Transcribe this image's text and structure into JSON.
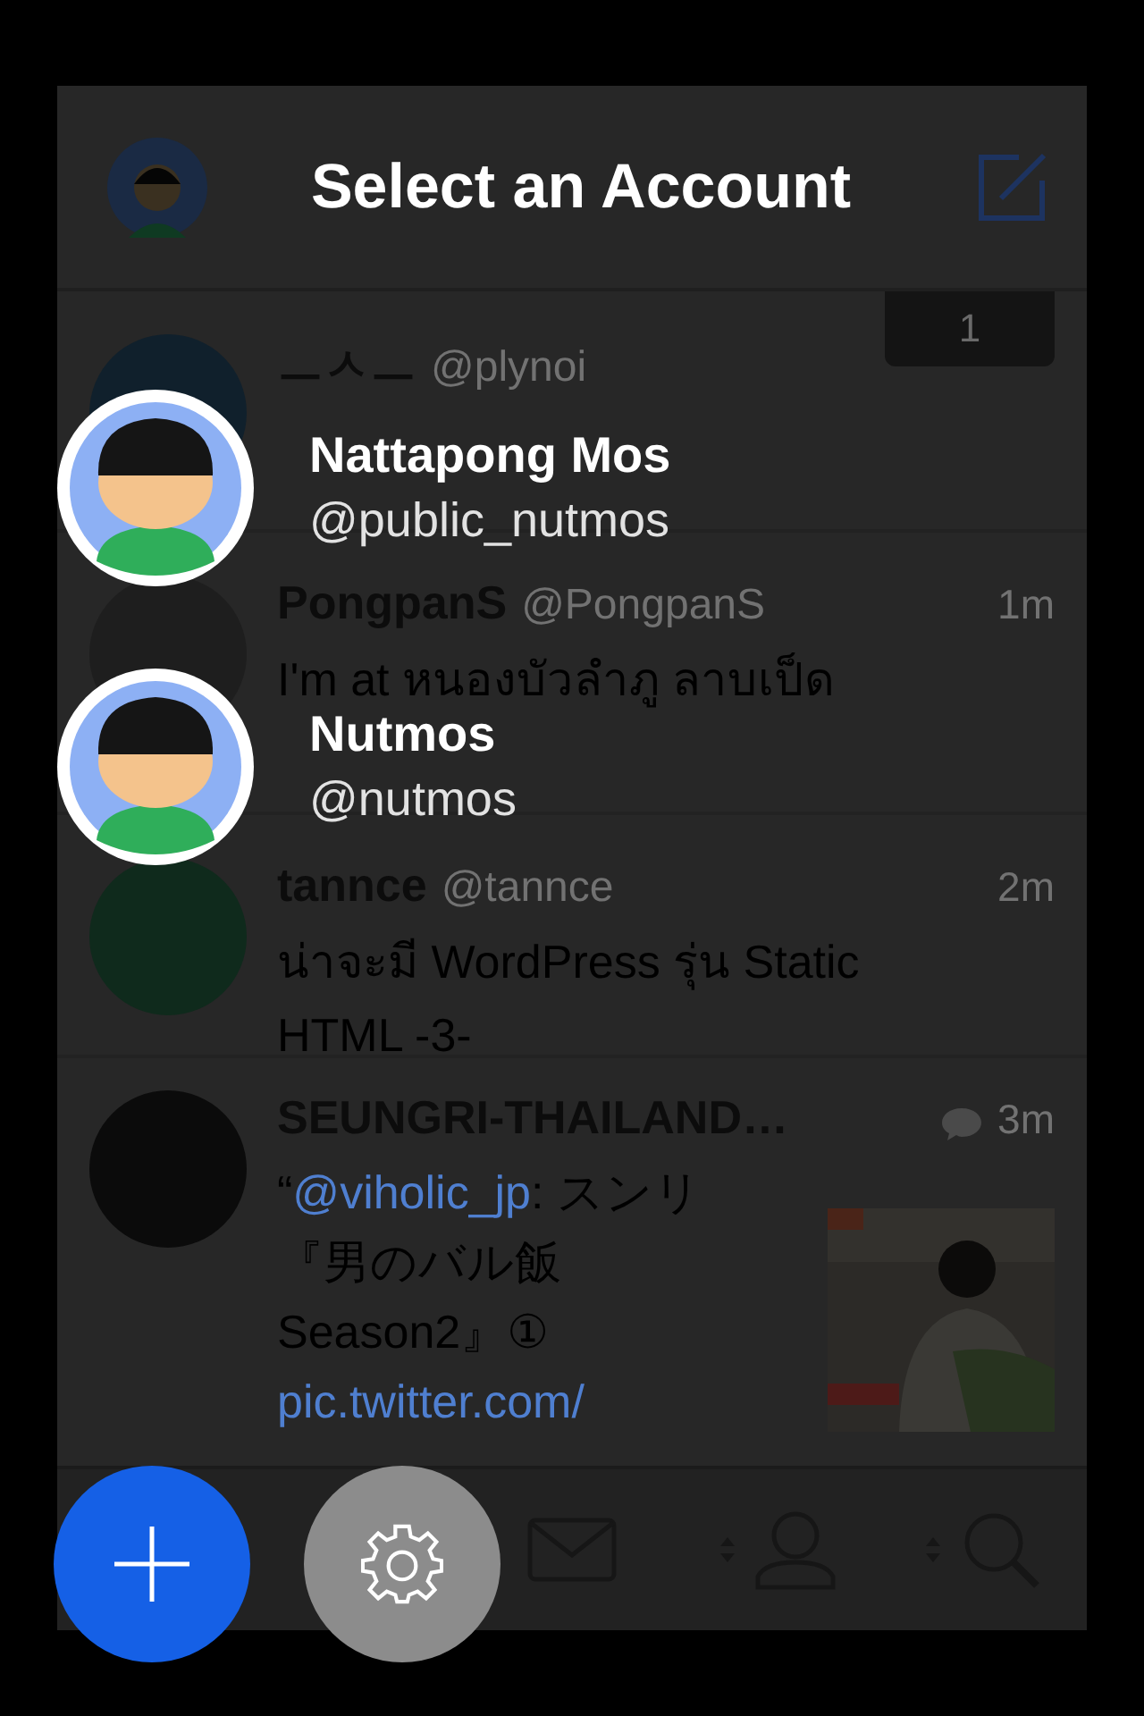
{
  "header": {
    "title": "Select an Account"
  },
  "timeline": {
    "new_count": "1",
    "tweets": [
      {
        "kind": "text",
        "name": "ㅡㅅㅡ",
        "handle": "@plynoi",
        "color": "#10202c"
      },
      {
        "kind": "text",
        "name": "PongpanS",
        "handle": "@PongpanS",
        "time": "1m",
        "color": "#1e1e1e",
        "lines": [
          [
            {
              "kind": "text",
              "text": "I'm at หนองบัวลำภู ลาบเป็ด"
            }
          ]
        ]
      },
      {
        "kind": "text",
        "name": "tannce",
        "handle": "@tannce",
        "time": "2m",
        "color": "#0f2a1c",
        "lines": [
          [
            {
              "kind": "text",
              "text": "น่าจะมี WordPress รุ่น Static"
            }
          ],
          [
            {
              "kind": "text",
              "text": "HTML -3-"
            }
          ]
        ]
      },
      {
        "name": "SEUNGRI-THAILAND…",
        "time": "3m",
        "color": "#0b0b0b",
        "lines": [
          [
            {
              "kind": "text",
              "text": "“"
            },
            {
              "kind": "link",
              "text": "@viholic_jp"
            },
            {
              "kind": "text",
              "text": ": スンリ"
            }
          ],
          [
            {
              "kind": "text",
              "text": "『男のバル飯"
            }
          ],
          [
            {
              "kind": "text",
              "text": "Season2』①"
            }
          ],
          [
            {
              "kind": "link",
              "text": "pic.twitter.com/"
            }
          ]
        ]
      }
    ]
  },
  "accounts": [
    {
      "name": "Nattapong Mos",
      "handle": "@public_nutmos"
    },
    {
      "name": "Nutmos",
      "handle": "@nutmos"
    }
  ]
}
